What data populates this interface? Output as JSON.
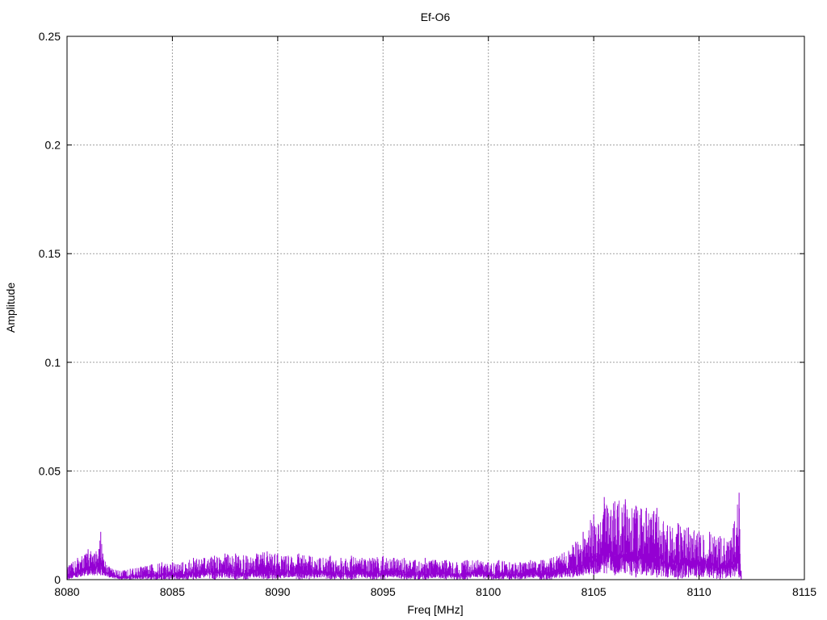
{
  "chart_data": {
    "type": "line",
    "title": "Ef-O6",
    "xlabel": "Freq [MHz]",
    "ylabel": "Amplitude",
    "xlim": [
      8080,
      8115
    ],
    "ylim": [
      0,
      0.25
    ],
    "xticks": [
      8080,
      8085,
      8090,
      8095,
      8100,
      8105,
      8110,
      8115
    ],
    "yticks": [
      0,
      0.05,
      0.1,
      0.15,
      0.2,
      0.25
    ],
    "xtick_labels": [
      "8080",
      "8085",
      "8090",
      "8095",
      "8100",
      "8105",
      "8110",
      "8115"
    ],
    "ytick_labels": [
      "0",
      "0.05",
      "0.1",
      "0.15",
      "0.2",
      "0.25"
    ],
    "grid": true,
    "legend": "none",
    "series": [
      {
        "color": "#9400d3",
        "x": [
          8080.0,
          8080.5,
          8081.0,
          8081.3,
          8081.6,
          8081.7,
          8082.0,
          8082.5,
          8083.0,
          8083.5,
          8084.0,
          8084.5,
          8085.0,
          8085.5,
          8086.0,
          8086.5,
          8087.0,
          8087.5,
          8088.0,
          8088.5,
          8089.0,
          8089.5,
          8090.0,
          8090.5,
          8091.0,
          8091.5,
          8092.0,
          8092.5,
          8093.0,
          8093.5,
          8094.0,
          8094.5,
          8095.0,
          8095.5,
          8096.0,
          8096.5,
          8097.0,
          8097.5,
          8098.0,
          8098.5,
          8099.0,
          8099.5,
          8100.0,
          8100.5,
          8101.0,
          8101.5,
          8102.0,
          8102.5,
          8103.0,
          8103.5,
          8104.0,
          8104.5,
          8105.0,
          8105.5,
          8106.0,
          8106.5,
          8107.0,
          8107.5,
          8108.0,
          8108.5,
          8109.0,
          8109.5,
          8110.0,
          8110.5,
          8111.0,
          8111.5,
          8111.9,
          8112.0
        ],
        "y_max": [
          0.006,
          0.01,
          0.014,
          0.012,
          0.022,
          0.012,
          0.006,
          0.004,
          0.005,
          0.006,
          0.007,
          0.008,
          0.008,
          0.008,
          0.01,
          0.01,
          0.011,
          0.012,
          0.012,
          0.011,
          0.012,
          0.013,
          0.012,
          0.011,
          0.012,
          0.011,
          0.01,
          0.011,
          0.01,
          0.011,
          0.01,
          0.01,
          0.011,
          0.01,
          0.01,
          0.009,
          0.01,
          0.009,
          0.009,
          0.008,
          0.009,
          0.009,
          0.008,
          0.009,
          0.008,
          0.008,
          0.009,
          0.009,
          0.01,
          0.012,
          0.016,
          0.022,
          0.03,
          0.038,
          0.036,
          0.037,
          0.034,
          0.033,
          0.033,
          0.025,
          0.026,
          0.024,
          0.022,
          0.022,
          0.02,
          0.018,
          0.04,
          0.004
        ],
        "y_min": [
          0.0,
          0.001,
          0.002,
          0.002,
          0.002,
          0.002,
          0.001,
          0.0,
          0.0,
          0.0,
          0.0,
          0.0,
          0.0,
          0.0,
          0.0,
          0.001,
          0.0,
          0.001,
          0.0,
          0.0,
          0.001,
          0.0,
          0.0,
          0.001,
          0.0,
          0.0,
          0.001,
          0.0,
          0.0,
          0.0,
          0.001,
          0.0,
          0.0,
          0.001,
          0.0,
          0.0,
          0.0,
          0.001,
          0.0,
          0.0,
          0.0,
          0.001,
          0.0,
          0.0,
          0.0,
          0.0,
          0.001,
          0.0,
          0.0,
          0.001,
          0.001,
          0.002,
          0.002,
          0.003,
          0.002,
          0.003,
          0.001,
          0.002,
          0.001,
          0.001,
          0.0,
          0.001,
          0.001,
          0.001,
          0.0,
          0.001,
          0.001,
          0.0
        ]
      }
    ]
  }
}
